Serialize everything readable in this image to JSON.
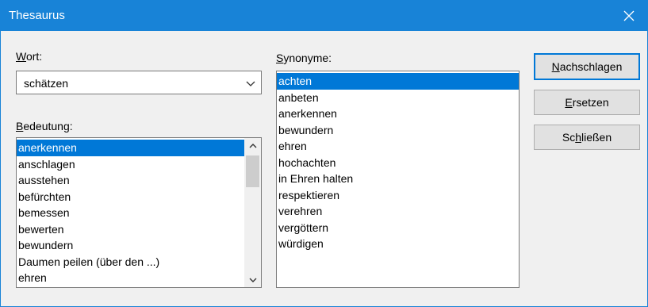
{
  "window": {
    "title": "Thesaurus"
  },
  "wort": {
    "label_access": "W",
    "label_rest": "ort:",
    "value": "schätzen"
  },
  "bedeutung": {
    "label_access": "B",
    "label_rest": "edeutung:",
    "items": [
      "anerkennen",
      "anschlagen",
      "ausstehen",
      "befürchten",
      "bemessen",
      "bewerten",
      "bewundern",
      "Daumen peilen (über den ...)",
      "ehren"
    ],
    "selected": "anerkennen"
  },
  "synonyme": {
    "label_access": "S",
    "label_rest": "ynonyme:",
    "items": [
      "achten",
      "anbeten",
      "anerkennen",
      "bewundern",
      "ehren",
      "hochachten",
      "in Ehren halten",
      "respektieren",
      "verehren",
      "vergöttern",
      "würdigen"
    ],
    "selected": "achten"
  },
  "buttons": {
    "lookup": {
      "access": "N",
      "rest": "achschlagen"
    },
    "replace": {
      "access": "E",
      "rest": "rsetzen"
    },
    "close": {
      "pre": "Sc",
      "access": "h",
      "rest": "ließen"
    }
  },
  "icons": {
    "close": "close-icon",
    "dropdown": "chevron-down-icon",
    "scroll_up": "chevron-up-icon",
    "scroll_down": "chevron-down-icon"
  },
  "colors": {
    "titlebar": "#1883d7",
    "selection": "#0078d7",
    "default_button_border": "#0078d7"
  }
}
